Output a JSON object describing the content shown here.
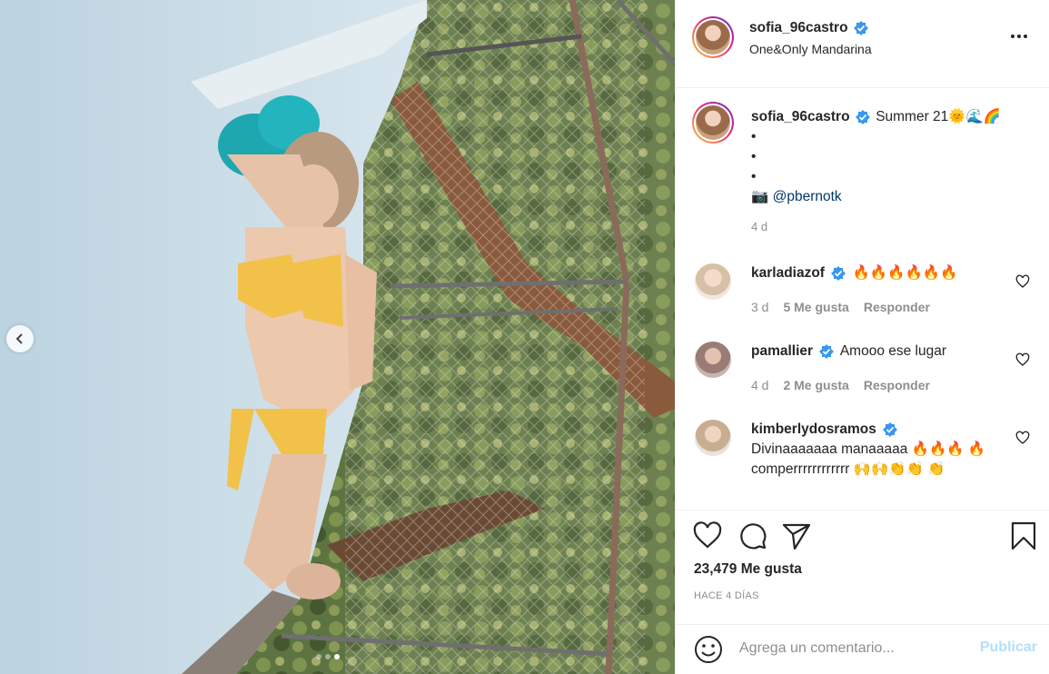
{
  "post": {
    "username": "sofia_96castro",
    "location": "One&Only Mandarina",
    "caption_text": "Summer 21🌞🌊🌈",
    "caption_dots": [
      "•",
      "•",
      "•"
    ],
    "caption_camera": "📷",
    "caption_tag": "@pbernotk",
    "caption_time": "4 d"
  },
  "comments": [
    {
      "username": "karladiazof",
      "text": "🔥🔥🔥🔥🔥🔥",
      "time": "3 d",
      "likes": "5 Me gusta",
      "reply": "Responder"
    },
    {
      "username": "pamallier",
      "text": "Amooo ese lugar",
      "time": "4 d",
      "likes": "2 Me gusta",
      "reply": "Responder"
    },
    {
      "username": "kimberlydosramos",
      "text": "Divinaaaaaaa manaaaaa 🔥🔥🔥 🔥 comperrrrrrrrrrrr 🙌🙌👏👏 👏"
    }
  ],
  "stats": {
    "likes": "23,479 Me gusta",
    "ago": "HACE 4 DÍAS"
  },
  "composer": {
    "placeholder": "Agrega un comentario...",
    "post_label": "Publicar"
  },
  "icons": {
    "verified": "verified-badge-icon",
    "more": "more-options-icon",
    "like": "heart-icon",
    "comment": "comment-bubble-icon",
    "share": "paper-plane-icon",
    "save": "bookmark-icon",
    "emoji": "smiley-icon",
    "prev": "chevron-left-icon"
  },
  "colors": {
    "link": "#00376b",
    "verified": "#3897f0",
    "muted": "#8e8e8e",
    "publish_disabled": "#b2dffc"
  },
  "carousel": {
    "total": 3,
    "active": 3
  }
}
